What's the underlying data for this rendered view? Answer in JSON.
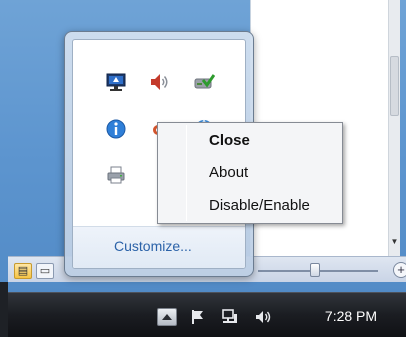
{
  "flyout": {
    "icons": [
      "monitor-network-icon",
      "speaker-icon",
      "disk-check-icon",
      "info-icon",
      "gear-tool-icon",
      "blue-globe-icon",
      "printer-icon"
    ],
    "customize_label": "Customize..."
  },
  "context_menu": {
    "items": [
      "Close",
      "About",
      "Disable/Enable"
    ],
    "default_item": "Close"
  },
  "taskbar": {
    "clock": "7:28 PM",
    "tray_icons": [
      "show-hidden-icons",
      "action-center-flag-icon",
      "network-icon",
      "volume-icon"
    ]
  },
  "colors": {
    "desktop": "#5d95cf",
    "taskbar": "#1b1d22",
    "link": "#2b62a8",
    "menu_bg": "#f4f5f7"
  }
}
